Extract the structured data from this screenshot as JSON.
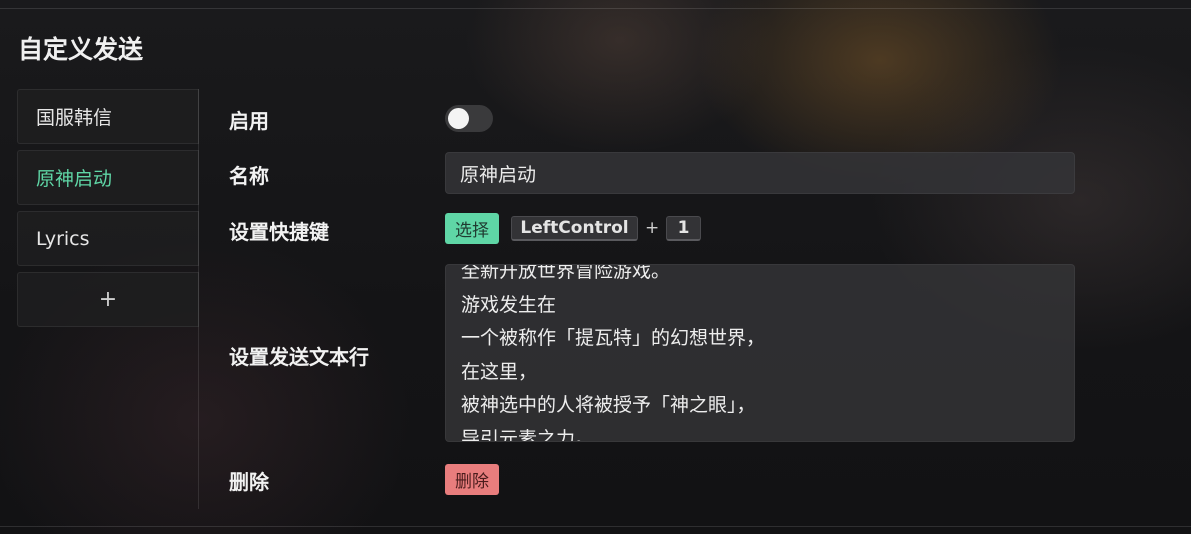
{
  "page": {
    "title": "自定义发送"
  },
  "sidebar": {
    "items": [
      {
        "label": "国服韩信"
      },
      {
        "label": "原神启动"
      },
      {
        "label": "Lyrics"
      }
    ],
    "add_label": "+"
  },
  "form": {
    "enabled": {
      "label": "启用",
      "value": false
    },
    "name": {
      "label": "名称",
      "value": "原神启动"
    },
    "hotkey": {
      "label": "设置快捷键",
      "select_label": "选择",
      "key1": "LeftControl",
      "plus": "+",
      "key2": "1"
    },
    "text_lines": {
      "label": "设置发送文本行",
      "lines": [
        "全新开放世界冒险游戏。",
        "游戏发生在",
        "一个被称作「提瓦特」的幻想世界，",
        "在这里，",
        "被神选中的人将被授予「神之眼」，",
        "导引元素之力。"
      ]
    },
    "delete": {
      "label": "删除",
      "button_label": "删除"
    }
  },
  "colors": {
    "accent": "#5fd6a6",
    "danger": "#e87d7d"
  }
}
